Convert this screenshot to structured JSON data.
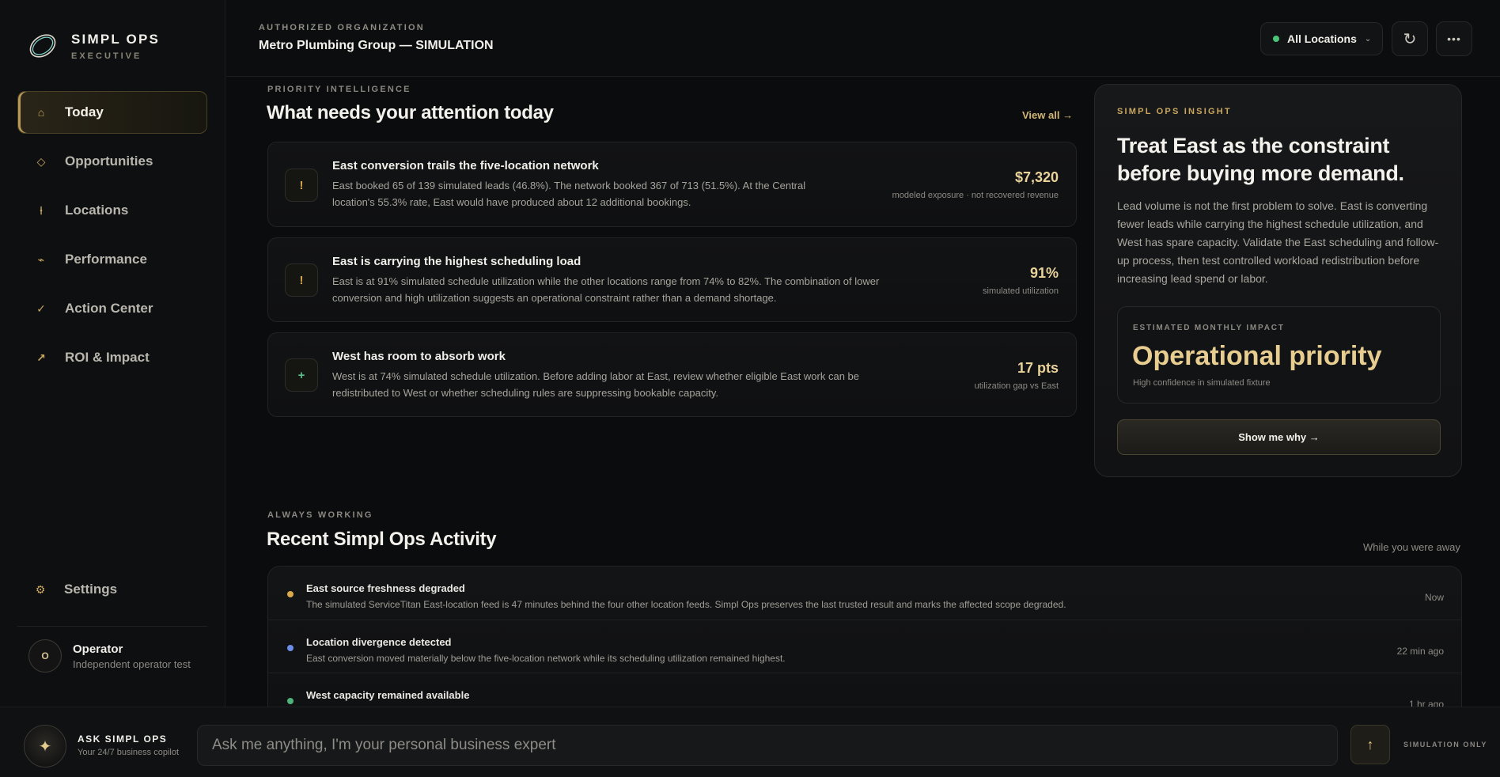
{
  "brand": {
    "name": "SIMPL OPS",
    "sub": "EXECUTIVE"
  },
  "nav": [
    {
      "label": "Today",
      "icon": "home-icon",
      "glyph": "⌂"
    },
    {
      "label": "Opportunities",
      "icon": "diamond-icon",
      "glyph": "◇"
    },
    {
      "label": "Locations",
      "icon": "pin-icon",
      "glyph": "⍿"
    },
    {
      "label": "Performance",
      "icon": "trend-icon",
      "glyph": "⌁"
    },
    {
      "label": "Action Center",
      "icon": "check-icon",
      "glyph": "✓"
    },
    {
      "label": "ROI & Impact",
      "icon": "arrow-up-right-icon",
      "glyph": "↗"
    }
  ],
  "settings": {
    "label": "Settings",
    "glyph": "⚙"
  },
  "operator": {
    "initial": "O",
    "name": "Operator",
    "sub": "Independent operator test"
  },
  "header": {
    "org_label": "AUTHORIZED ORGANIZATION",
    "org_name": "Metro Plumbing Group — SIMULATION",
    "location": "All Locations",
    "refresh_glyph": "↻",
    "more_glyph": "•••"
  },
  "priority": {
    "label": "PRIORITY INTELLIGENCE",
    "title": "What needs your attention today",
    "view_all": "View all →",
    "cards": [
      {
        "glyph": "!",
        "title": "East conversion trails the five-location network",
        "body_1": "East booked 65 of 139 simulated leads (46.8%). The network booked 367 of 713 (51.5%). At the Central",
        "body_2": "location's 55.3% rate, East would have produced about 12 additional bookings.",
        "value": "$7,320",
        "value_sub": "modeled exposure · not recovered revenue"
      },
      {
        "glyph": "!",
        "title": "East is carrying the highest scheduling load",
        "body_1": "East is at 91% simulated schedule utilization while the other locations range from 74% to 82%. The combination of lower",
        "body_2": "conversion and high utilization suggests an operational constraint rather than a demand shortage.",
        "value": "91%",
        "value_sub": "simulated utilization"
      },
      {
        "glyph": "+",
        "title": "West has room to absorb work",
        "body_1": "West is at 74% simulated schedule utilization. Before adding labor at East, review whether eligible East work can be",
        "body_2": "redistributed to West or whether scheduling rules are suppressing bookable capacity.",
        "value": "17 pts",
        "value_sub": "utilization gap vs East"
      }
    ]
  },
  "insight": {
    "label": "SIMPL OPS INSIGHT",
    "title": "Treat East as the constraint before buying more demand.",
    "body": "Lead volume is not the first problem to solve. East is converting fewer leads while carrying the highest schedule utilization, and West has spare capacity. Validate the East scheduling and follow-up process, then test controlled workload redistribution before increasing lead spend or labor.",
    "impact_label": "ESTIMATED MONTHLY IMPACT",
    "impact_value": "Operational priority",
    "impact_sub": "High confidence in simulated fixture",
    "button": "Show me why →"
  },
  "activity": {
    "label": "ALWAYS WORKING",
    "title": "Recent Simpl Ops Activity",
    "while_away": "While you were away",
    "items": [
      {
        "title": "East source freshness degraded",
        "body": "The simulated ServiceTitan East-location feed is 47 minutes behind the four other location feeds. Simpl Ops preserves the last trusted result and marks the affected scope degraded.",
        "time": "Now",
        "color": "#d9a94a"
      },
      {
        "title": "Location divergence detected",
        "body": "East conversion moved materially below the five-location network while its scheduling utilization remained highest.",
        "time": "22 min ago",
        "color": "#6d8ee8"
      },
      {
        "title": "West capacity remained available",
        "body": "",
        "time": "1 hr ago",
        "color": "#4db37a"
      }
    ]
  },
  "ask": {
    "title": "ASK SIMPL OPS",
    "sub": "Your 24/7 business copilot",
    "placeholder": "Ask me anything, I'm your personal business expert",
    "send_glyph": "↑",
    "mode": "SIMULATION ONLY"
  }
}
